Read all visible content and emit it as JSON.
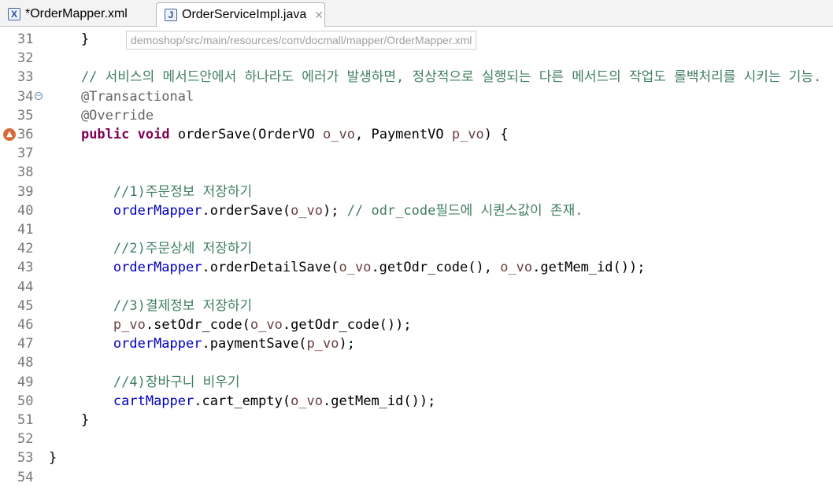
{
  "tabs": [
    {
      "label": "*OrderMapper.xml",
      "icon": "xml-file-icon",
      "active": false
    },
    {
      "label": "OrderServiceImpl.java",
      "icon": "java-file-icon",
      "active": true
    }
  ],
  "hover_path": "demoshop/src/main/resources/com/docmall/mapper/OrderMapper.xml",
  "lines": [
    {
      "n": "31",
      "segs": [
        {
          "t": "    }",
          "c": ""
        }
      ]
    },
    {
      "n": "32",
      "segs": []
    },
    {
      "n": "33",
      "segs": [
        {
          "t": "    // 서비스의 메서드안에서 하나라도 에러가 발생하면, 정상적으로 실행되는 다른 메서드의 작업도 롤백처리를 시키는 기능.",
          "c": "cm"
        }
      ]
    },
    {
      "n": "34",
      "fold": true,
      "segs": [
        {
          "t": "    @Transactional",
          "c": "ann"
        }
      ]
    },
    {
      "n": "35",
      "segs": [
        {
          "t": "    @Override",
          "c": "ann"
        }
      ]
    },
    {
      "n": "36",
      "marker": true,
      "segs": [
        {
          "t": "    ",
          "c": ""
        },
        {
          "t": "public",
          "c": "kw"
        },
        {
          "t": " ",
          "c": ""
        },
        {
          "t": "void",
          "c": "kw"
        },
        {
          "t": " orderSave(OrderVO ",
          "c": ""
        },
        {
          "t": "o_vo",
          "c": "var"
        },
        {
          "t": ", PaymentVO ",
          "c": ""
        },
        {
          "t": "p_vo",
          "c": "var"
        },
        {
          "t": ") {",
          "c": ""
        }
      ]
    },
    {
      "n": "37",
      "segs": []
    },
    {
      "n": "38",
      "segs": []
    },
    {
      "n": "39",
      "segs": [
        {
          "t": "        //1)주문정보 저장하기",
          "c": "cm"
        }
      ]
    },
    {
      "n": "40",
      "segs": [
        {
          "t": "        ",
          "c": ""
        },
        {
          "t": "orderMapper",
          "c": "fld"
        },
        {
          "t": ".orderSave(",
          "c": ""
        },
        {
          "t": "o_vo",
          "c": "var"
        },
        {
          "t": "); ",
          "c": ""
        },
        {
          "t": "// odr_code필드에 시퀀스값이 존재.",
          "c": "cm"
        }
      ]
    },
    {
      "n": "41",
      "segs": []
    },
    {
      "n": "42",
      "segs": [
        {
          "t": "        //2)주문상세 저장하기",
          "c": "cm"
        }
      ]
    },
    {
      "n": "43",
      "segs": [
        {
          "t": "        ",
          "c": ""
        },
        {
          "t": "orderMapper",
          "c": "fld"
        },
        {
          "t": ".orderDetailSave(",
          "c": ""
        },
        {
          "t": "o_vo",
          "c": "var"
        },
        {
          "t": ".getOdr_code(), ",
          "c": ""
        },
        {
          "t": "o_vo",
          "c": "var"
        },
        {
          "t": ".getMem_id());",
          "c": ""
        }
      ]
    },
    {
      "n": "44",
      "segs": []
    },
    {
      "n": "45",
      "segs": [
        {
          "t": "        //3)결제정보 저장하기",
          "c": "cm"
        }
      ]
    },
    {
      "n": "46",
      "segs": [
        {
          "t": "        ",
          "c": ""
        },
        {
          "t": "p_vo",
          "c": "var"
        },
        {
          "t": ".setOdr_code(",
          "c": ""
        },
        {
          "t": "o_vo",
          "c": "var"
        },
        {
          "t": ".getOdr_code());",
          "c": ""
        }
      ]
    },
    {
      "n": "47",
      "segs": [
        {
          "t": "        ",
          "c": ""
        },
        {
          "t": "orderMapper",
          "c": "fld"
        },
        {
          "t": ".paymentSave(",
          "c": ""
        },
        {
          "t": "p_vo",
          "c": "var"
        },
        {
          "t": ");",
          "c": ""
        }
      ]
    },
    {
      "n": "48",
      "segs": []
    },
    {
      "n": "49",
      "segs": [
        {
          "t": "        //4)장바구니 비우기",
          "c": "cm"
        }
      ]
    },
    {
      "n": "50",
      "segs": [
        {
          "t": "        ",
          "c": ""
        },
        {
          "t": "cartMapper",
          "c": "fld"
        },
        {
          "t": ".cart_empty(",
          "c": ""
        },
        {
          "t": "o_vo",
          "c": "var"
        },
        {
          "t": ".getMem_id());",
          "c": ""
        }
      ]
    },
    {
      "n": "51",
      "segs": [
        {
          "t": "    }",
          "c": ""
        }
      ]
    },
    {
      "n": "52",
      "segs": []
    },
    {
      "n": "53",
      "segs": [
        {
          "t": "}",
          "c": ""
        }
      ]
    },
    {
      "n": "54",
      "segs": []
    }
  ]
}
